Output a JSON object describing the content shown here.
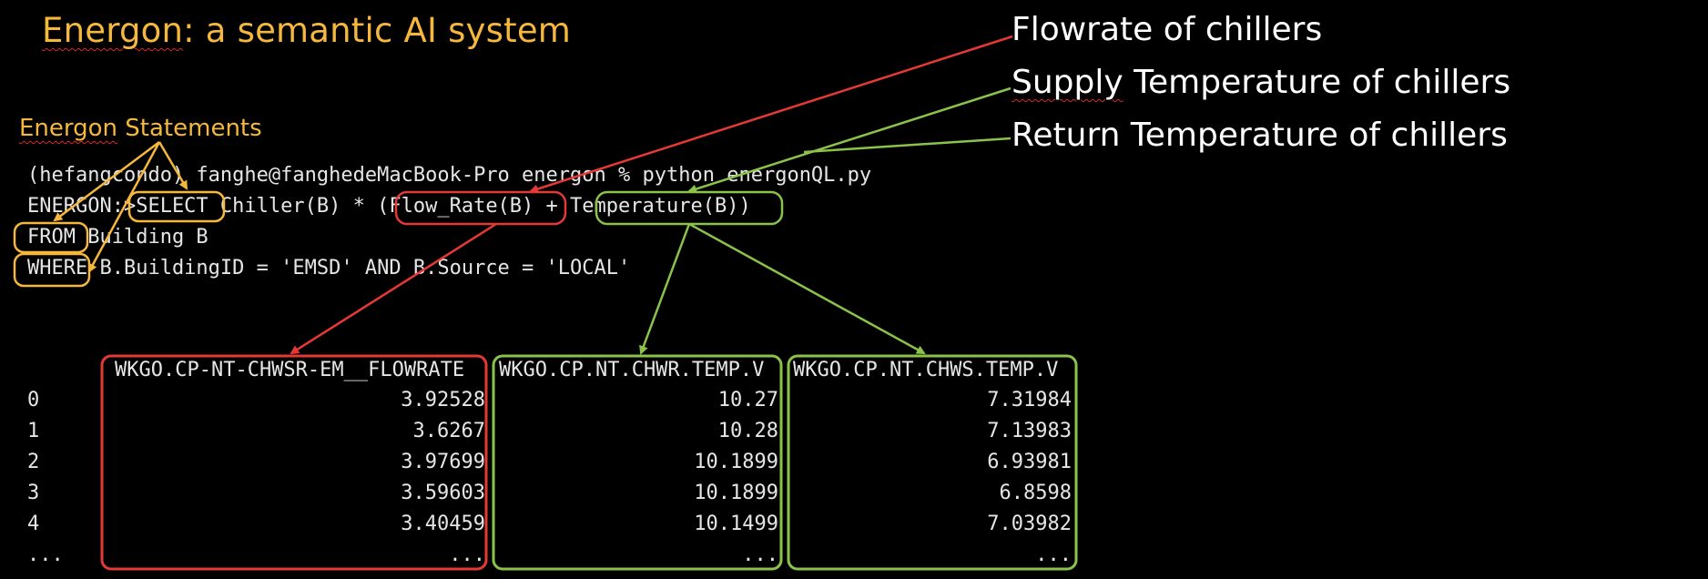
{
  "slide": {
    "title_underlined": "Energon",
    "title_rest": ": a semantic AI system",
    "subtitle_underlined": "Energon",
    "subtitle_rest": " Statements"
  },
  "annotations": {
    "flowrate": "Flowrate of chillers",
    "supply_underlined": "Supply",
    "supply_rest": " Temperature of chillers",
    "return": "Return Temperature of chillers"
  },
  "terminal": {
    "prompt_line": "(hefangcondo) fanghe@fanghedeMacBook-Pro energon % python energonQL.py",
    "query_line": "ENERGON:>SELECT Chiller(B) * (Flow_Rate(B) + Temperature(B))",
    "from_line": "FROM Building B",
    "where_line": "WHERE B.BuildingID = 'EMSD' AND B.Source = 'LOCAL'"
  },
  "table": {
    "columns": [
      "WKGO.CP-NT-CHWSR-EM__FLOWRATE",
      "WKGO.CP.NT.CHWR.TEMP.V",
      "WKGO.CP.NT.CHWS.TEMP.V"
    ],
    "index": [
      "0",
      "1",
      "2",
      "3",
      "4",
      "..."
    ],
    "rows": [
      [
        "3.92528",
        "10.27",
        "7.31984"
      ],
      [
        "3.6267",
        "10.28",
        "7.13983"
      ],
      [
        "3.97699",
        "10.1899",
        "6.93981"
      ],
      [
        "3.59603",
        "10.1899",
        "6.8598"
      ],
      [
        "3.40459",
        "10.1499",
        "7.03982"
      ],
      [
        "...",
        "...",
        "..."
      ]
    ]
  },
  "colors": {
    "background": "#000000",
    "title": "#f5b83d",
    "annotation_text": "#ffffff",
    "flow_highlight": "#e53935",
    "temp_highlight": "#8bc34a",
    "keyword_highlight": "#f5b83d",
    "terminal_text": "#e6e6e6"
  }
}
